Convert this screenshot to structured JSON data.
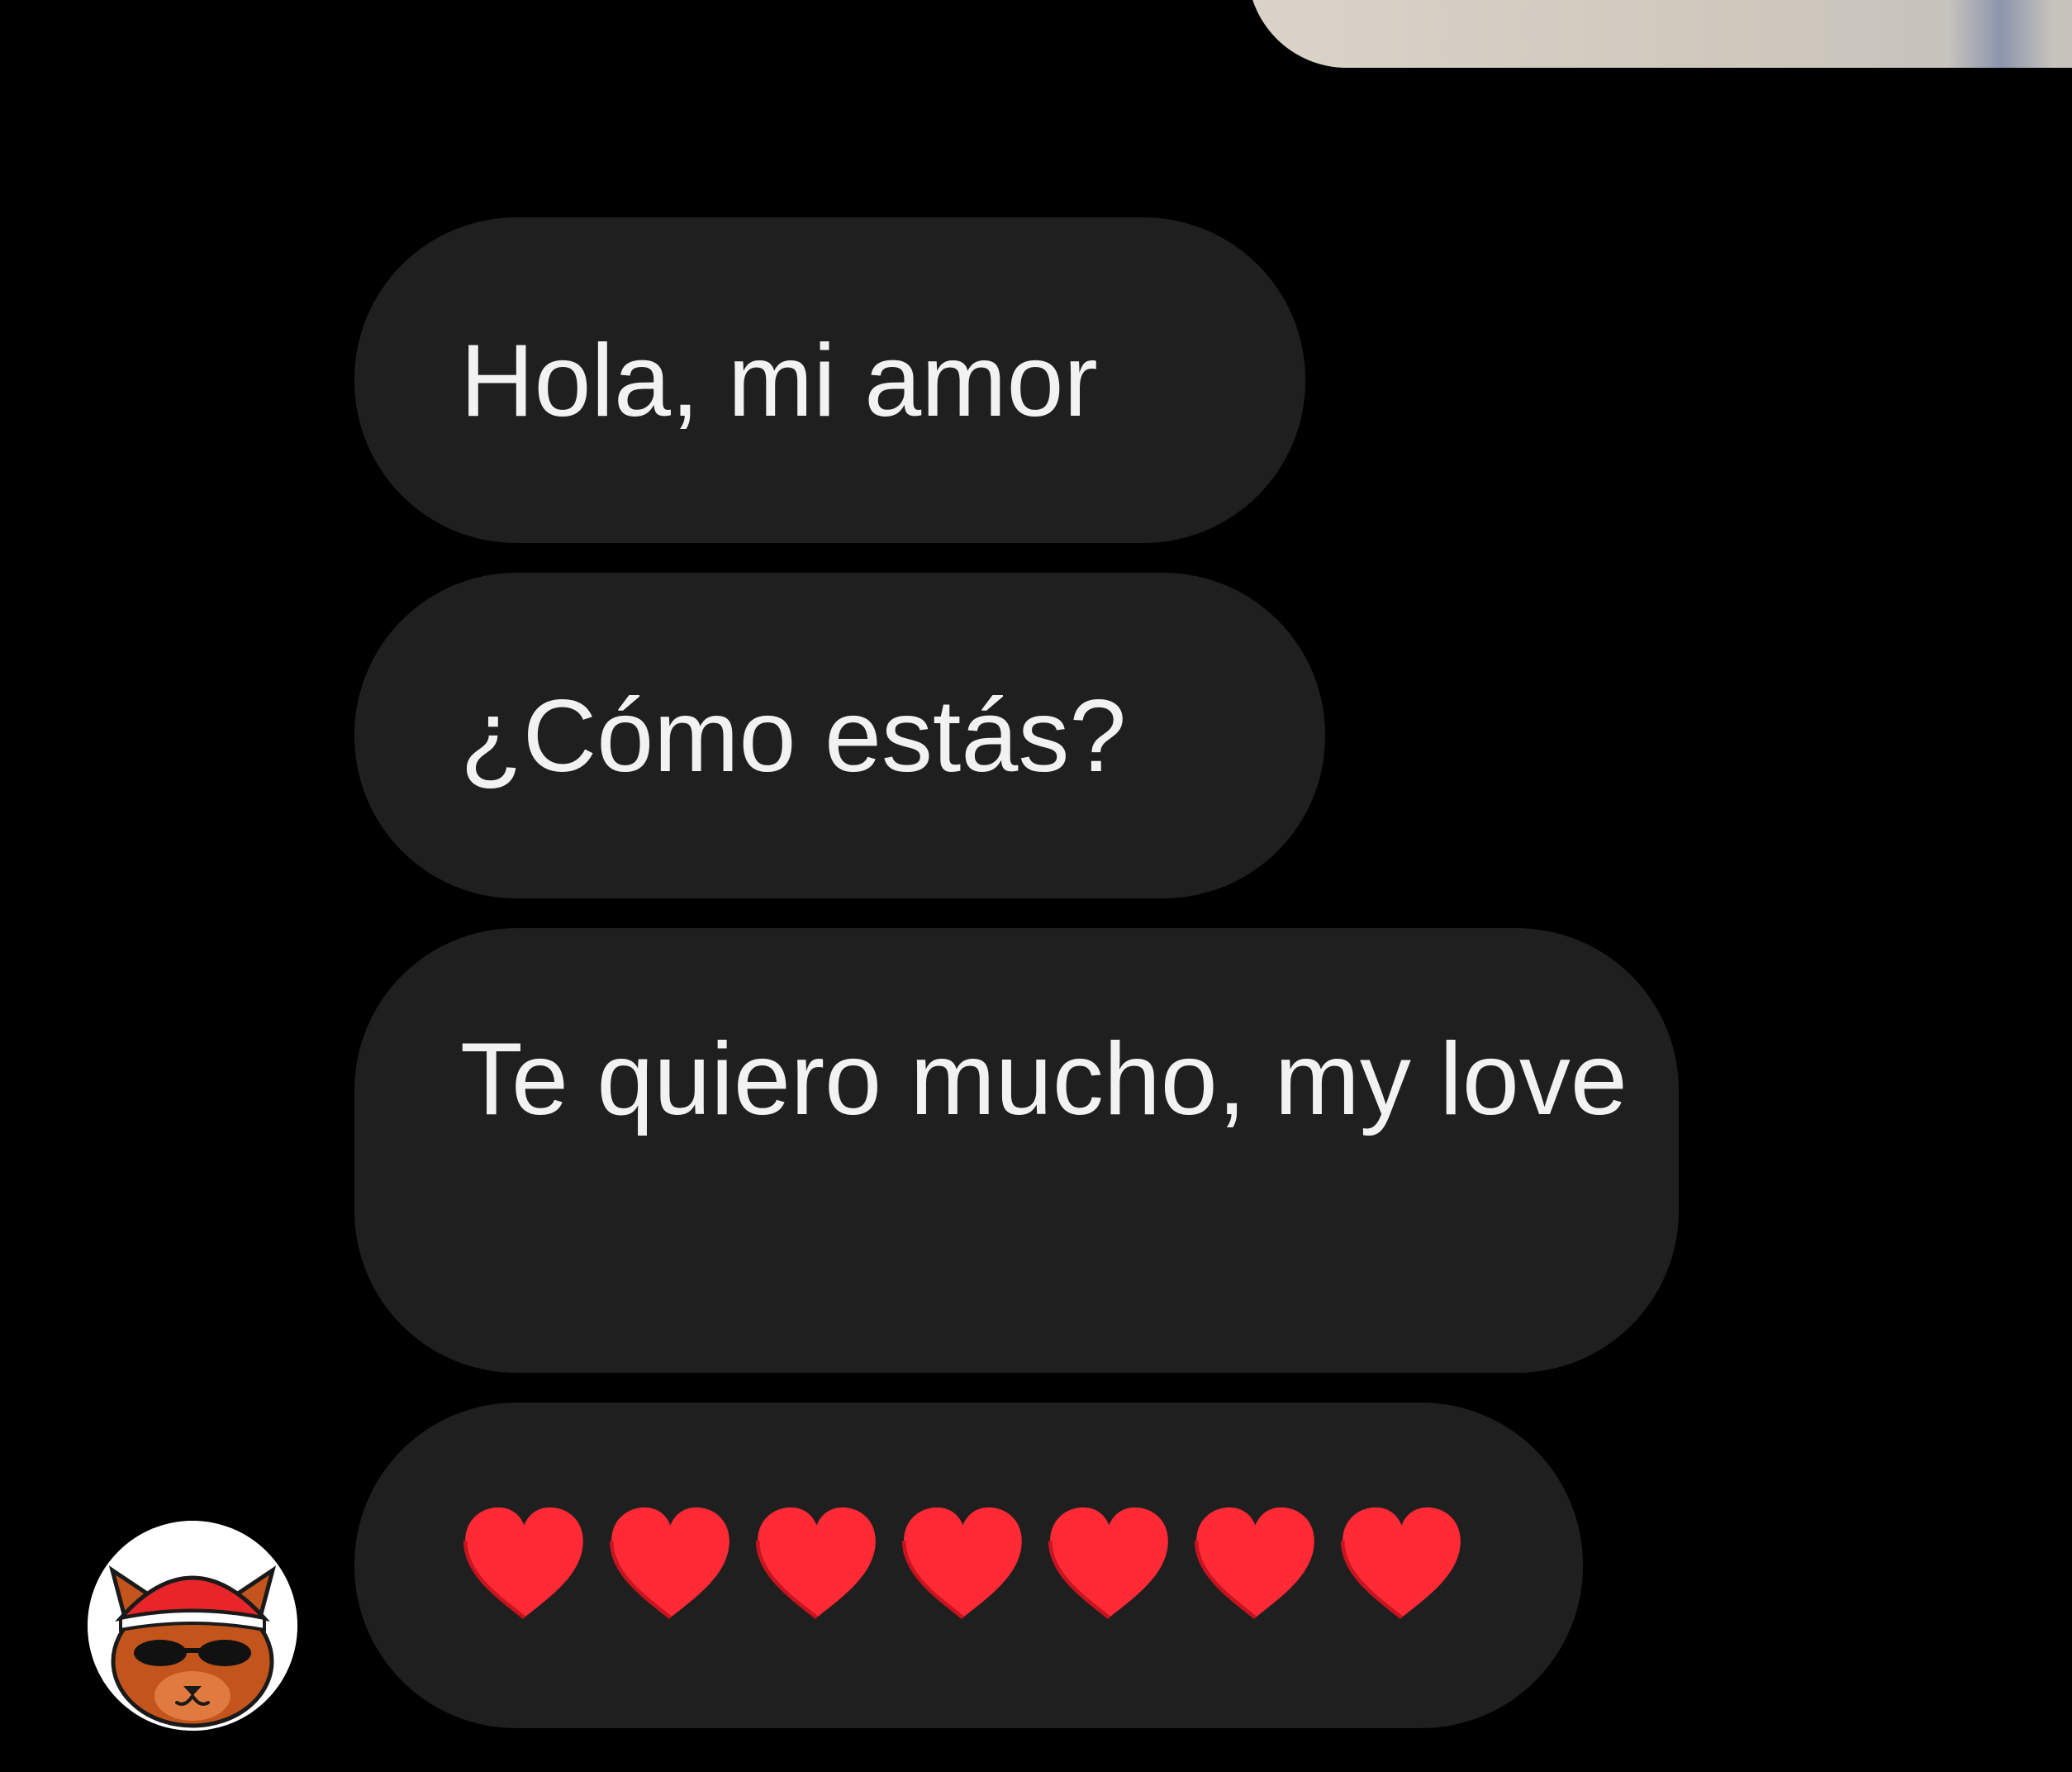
{
  "messages": [
    {
      "text": "Hola, mi amor"
    },
    {
      "text": "¿Cómo estás?"
    },
    {
      "text": "Te quiero mucho, my love"
    },
    {
      "emoji": "heart",
      "count": 7
    }
  ],
  "colors": {
    "background": "#000000",
    "bubble": "#1f1f1f",
    "text": "#f2f2f2",
    "heart": "#ff2a36"
  },
  "avatar": {
    "icon": "fox-with-red-cap-and-sunglasses-icon"
  }
}
